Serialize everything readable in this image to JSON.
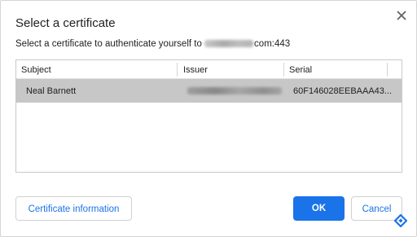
{
  "dialog": {
    "title": "Select a certificate",
    "subtitle_prefix": "Select a certificate to authenticate yourself to ",
    "subtitle_suffix": "com:443",
    "close_icon": "close-icon"
  },
  "table": {
    "columns": [
      "Subject",
      "Issuer",
      "Serial"
    ],
    "rows": [
      {
        "subject": "Neal Barnett",
        "serial": "60F146028EEBAAA43..."
      }
    ],
    "selected_row_color": "#c7c7c7"
  },
  "buttons": {
    "info_label": "Certificate information",
    "ok_label": "OK",
    "cancel_label": "Cancel"
  },
  "colors": {
    "accent": "#1a73e8",
    "border": "#d0d0d0"
  },
  "watermark_icon": "brand-logo-icon"
}
